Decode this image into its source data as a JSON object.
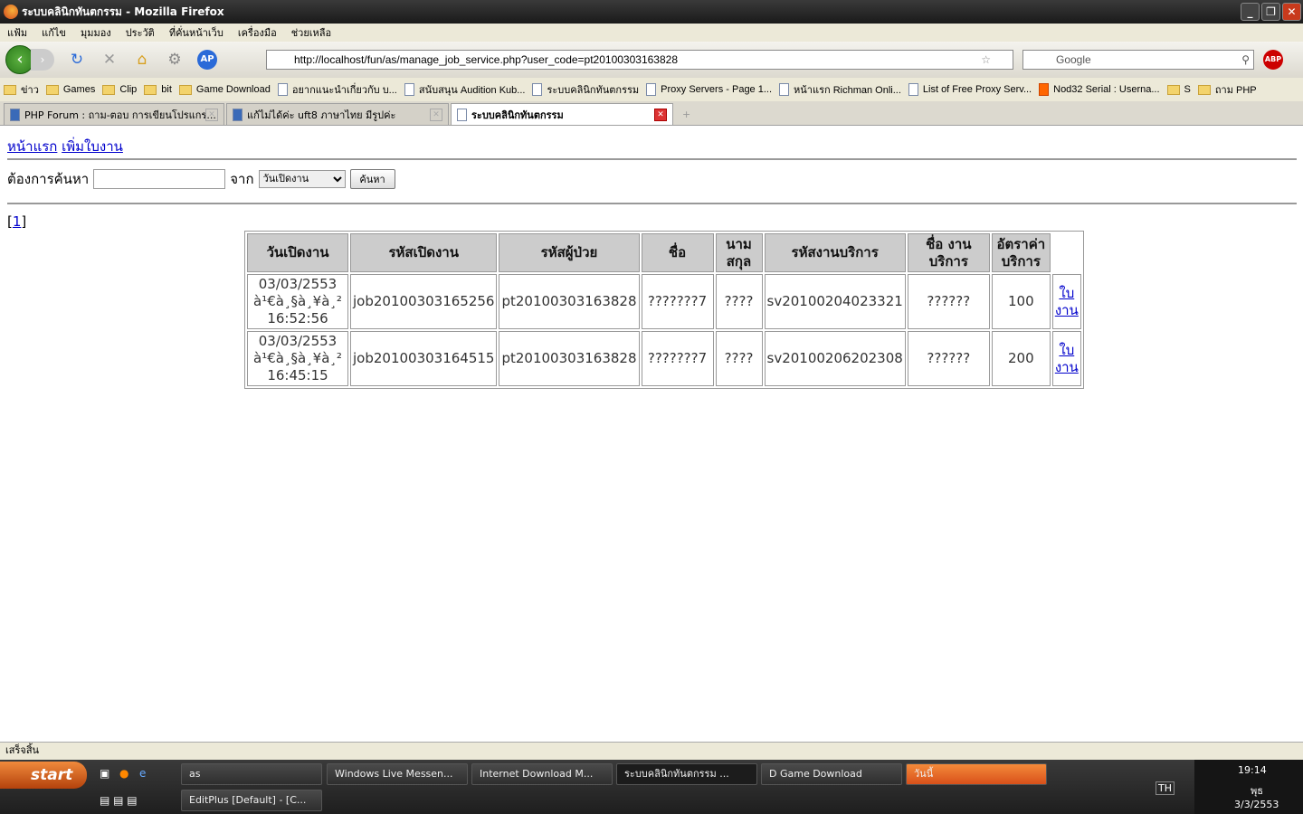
{
  "window": {
    "title": "ระบบคลินิกทันตกรรม - Mozilla Firefox"
  },
  "menu": [
    "แฟ้ม",
    "แก้ไข",
    "มุมมอง",
    "ประวัติ",
    "ที่คั่นหน้าเว็บ",
    "เครื่องมือ",
    "ช่วยเหลือ"
  ],
  "nav": {
    "url": "http://localhost/fun/as/manage_job_service.php?user_code=pt20100303163828",
    "search_placeholder": "Google",
    "abp": "ABP"
  },
  "bookmarks": [
    {
      "label": "ข่าว",
      "icon": "folder"
    },
    {
      "label": "Games",
      "icon": "folder"
    },
    {
      "label": "Clip",
      "icon": "folder"
    },
    {
      "label": "bit",
      "icon": "folder"
    },
    {
      "label": "Game Download",
      "icon": "folder"
    },
    {
      "label": "อยากแนะนำเกี่ยวกับ บ...",
      "icon": "page"
    },
    {
      "label": "สนับสนุน Audition Kub...",
      "icon": "page"
    },
    {
      "label": "ระบบคลินิกทันตกรรม",
      "icon": "page"
    },
    {
      "label": "Proxy Servers - Page 1...",
      "icon": "page"
    },
    {
      "label": "หน้าแรก Richman Onli...",
      "icon": "page"
    },
    {
      "label": "List of Free Proxy Serv...",
      "icon": "page"
    },
    {
      "label": "Nod32 Serial : Userna...",
      "icon": "blogger"
    },
    {
      "label": "S",
      "icon": "folder"
    },
    {
      "label": "ถาม PHP",
      "icon": "folder"
    }
  ],
  "tabs": [
    {
      "label": "PHP Forum : ถาม-ตอบ การเขียนโปรแกร...",
      "active": false
    },
    {
      "label": "แก้ไม่ได้ค่ะ uft8 ภาษาไทย มีรูปค่ะ",
      "active": false
    },
    {
      "label": "ระบบคลินิกทันตกรรม",
      "active": true
    }
  ],
  "page": {
    "links": [
      "หน้าแรก",
      "เพิ่มใบงาน"
    ],
    "search_label": "ต้องการค้นหา",
    "search_value": "",
    "from_label": "จาก",
    "from_selected": "วันเปิดงาน",
    "search_button": "ค้นหา",
    "pager_open": "[",
    "pager_page": "1",
    "pager_close": "]",
    "table": {
      "headers": [
        "วันเปิดงาน",
        "รหัสเปิดงาน",
        "รหัสผู้ป่วย",
        "ชื่อ",
        "นาม สกุล",
        "รหัสงานบริการ",
        "ชื่อ งานบริการ",
        "อัตราค่า บริการ"
      ],
      "rows": [
        [
          "03/03/2553 à¹€à¸§à¸¥à¸² 16:52:56",
          "job20100303165256",
          "pt20100303163828",
          "???????7",
          "????",
          "sv20100204023321",
          "??????",
          "100",
          "ใบงาน"
        ],
        [
          "03/03/2553 à¹€à¸§à¸¥à¸² 16:45:15",
          "job20100303164515",
          "pt20100303163828",
          "???????7",
          "????",
          "sv20100206202308",
          "??????",
          "200",
          "ใบงาน"
        ]
      ]
    }
  },
  "status": "เสร็จสิ้น",
  "taskbar": {
    "start": "start",
    "tasks": [
      "as",
      "Windows Live Messen...",
      "Internet Download M...",
      "ระบบคลินิกทันตกรรม ...",
      "D Game Download",
      "วันนี้",
      "EditPlus [Default] - [C..."
    ],
    "lang": "TH",
    "time": "19:14",
    "day": "พุธ",
    "date": "3/3/2553"
  }
}
